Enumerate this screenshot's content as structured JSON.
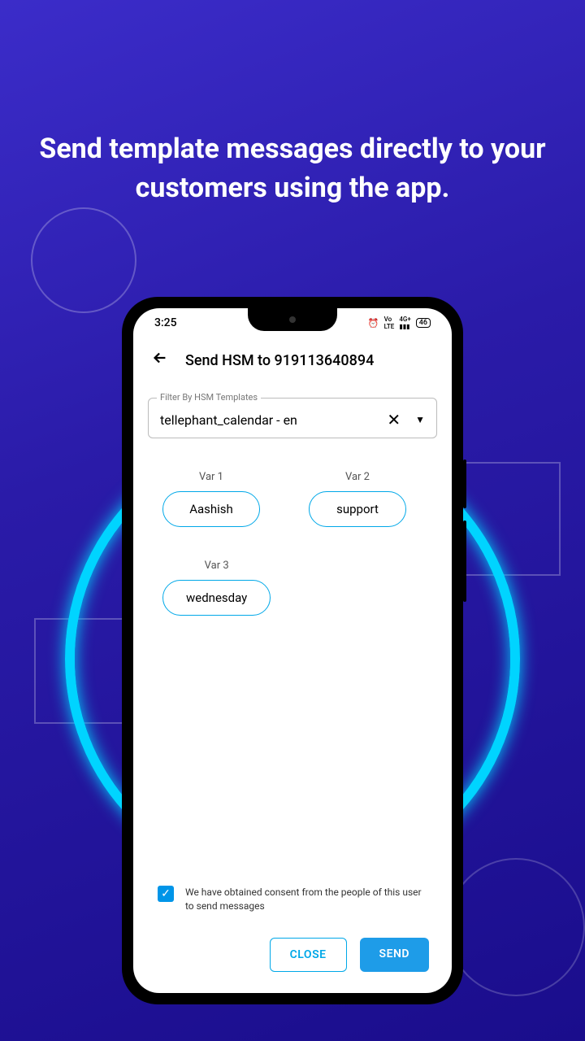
{
  "headline": "Send template messages directly to your customers using the app.",
  "status": {
    "time": "3:25",
    "alarm": "⏰",
    "net": "⁴ᴳ",
    "signal": "📶",
    "battery": "46"
  },
  "header": {
    "title": "Send HSM to 919113640894"
  },
  "select": {
    "label": "Filter By HSM Templates",
    "value": "tellephant_calendar - en"
  },
  "vars": [
    {
      "label": "Var 1",
      "value": "Aashish"
    },
    {
      "label": "Var 2",
      "value": "support"
    },
    {
      "label": "Var 3",
      "value": "wednesday"
    }
  ],
  "consent": {
    "text": "We have obtained consent from the people of this user to send messages"
  },
  "buttons": {
    "close": "CLOSE",
    "send": "SEND"
  }
}
